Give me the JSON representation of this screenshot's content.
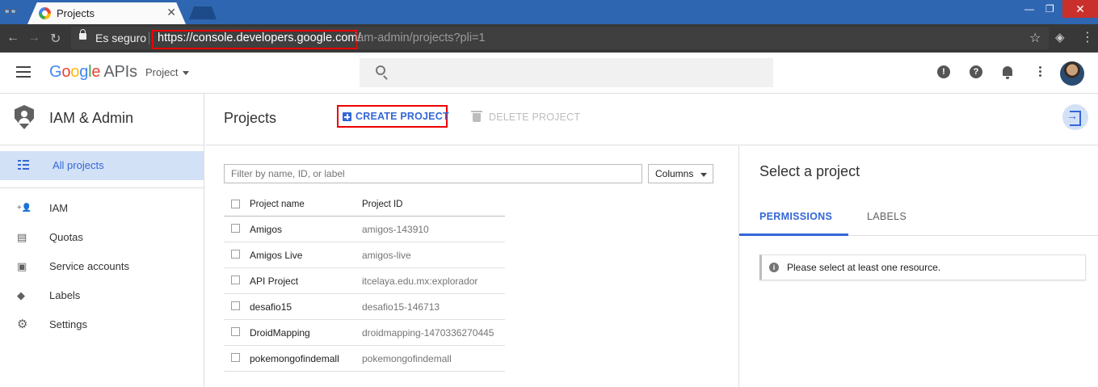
{
  "browser": {
    "tab_title": "Projects",
    "tab_close": "✕",
    "minimize": "—",
    "restore": "❐",
    "close": "✕",
    "secure_label": "Es seguro",
    "url_host": "https://console.developers.google.com/",
    "url_path": "iam-admin/projects?pli=1"
  },
  "header": {
    "logo_google": [
      "G",
      "o",
      "o",
      "g",
      "l",
      "e"
    ],
    "logo_apis": "APIs",
    "project_selector": "Project",
    "search_placeholder": "",
    "feedback_icon_glyph": "!",
    "help_icon_glyph": "?"
  },
  "sidebar": {
    "title": "IAM & Admin",
    "active_item": "All projects",
    "items": [
      {
        "label": "IAM",
        "icon": "person-add-icon",
        "glyph": "+👤"
      },
      {
        "label": "Quotas",
        "icon": "quotas-icon",
        "glyph": "▤"
      },
      {
        "label": "Service accounts",
        "icon": "service-account-icon",
        "glyph": "▣"
      },
      {
        "label": "Labels",
        "icon": "label-icon",
        "glyph": "◆"
      },
      {
        "label": "Settings",
        "icon": "settings-icon",
        "glyph": "⚙"
      }
    ]
  },
  "main": {
    "title": "Projects",
    "create_label": "CREATE PROJECT",
    "delete_label": "DELETE PROJECT",
    "filter_placeholder": "Filter by name, ID, or label",
    "columns_label": "Columns",
    "table": {
      "headers": [
        "Project name",
        "Project ID"
      ],
      "rows": [
        {
          "name": "Amigos",
          "id": "amigos-143910"
        },
        {
          "name": "Amigos Live",
          "id": "amigos-live"
        },
        {
          "name": "API Project",
          "id": "itcelaya.edu.mx:explorador"
        },
        {
          "name": "desafio15",
          "id": "desafio15-146713"
        },
        {
          "name": "DroidMapping",
          "id": "droidmapping-1470336270445"
        },
        {
          "name": "pokemongofindemall",
          "id": "pokemongofindemall"
        }
      ]
    }
  },
  "right_panel": {
    "title": "Select a project",
    "tabs": [
      "PERMISSIONS",
      "LABELS"
    ],
    "active_tab": "PERMISSIONS",
    "info_message": "Please select at least one resource."
  },
  "colors": {
    "accent": "#3367d6",
    "tabstrip": "#2e66b1",
    "highlight_box": "#e00000"
  }
}
